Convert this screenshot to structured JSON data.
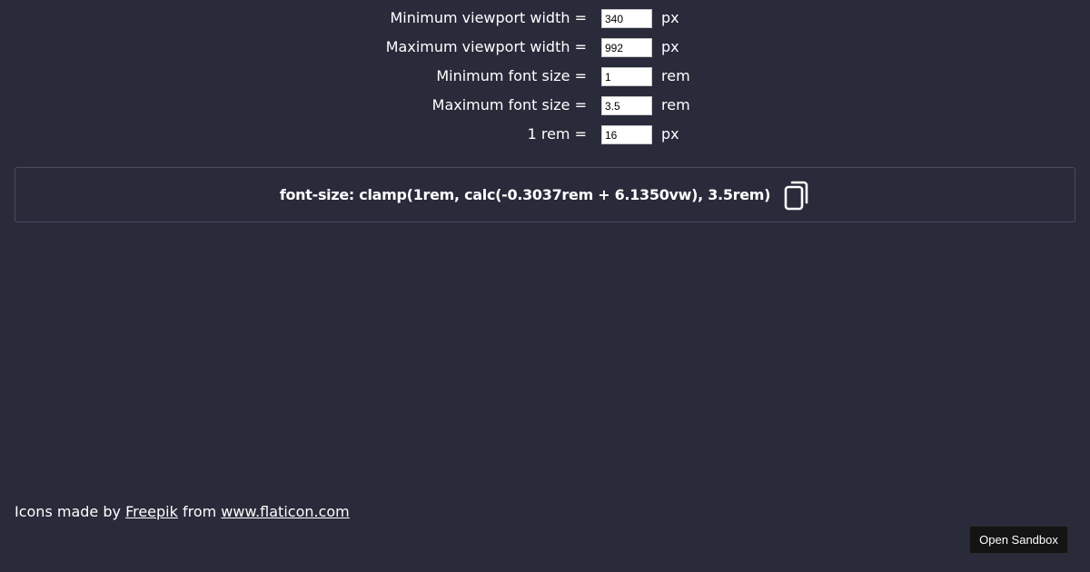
{
  "form": {
    "rows": [
      {
        "label": "Minimum viewport width =",
        "value": "340",
        "unit": "px"
      },
      {
        "label": "Maximum viewport width =",
        "value": "992",
        "unit": "px"
      },
      {
        "label": "Minimum font size =",
        "value": "1",
        "unit": "rem"
      },
      {
        "label": "Maximum font size =",
        "value": "3.5",
        "unit": "rem"
      },
      {
        "label": "1 rem =",
        "value": "16",
        "unit": "px"
      }
    ]
  },
  "result": {
    "code": "font-size: clamp(1rem, calc(-0.3037rem + 6.1350vw), 3.5rem)",
    "copy_icon": "copy-icon"
  },
  "credits": {
    "prefix": "Icons made by ",
    "author_link": "Freepik",
    "middle": " from ",
    "site_link": "www.flaticon.com"
  },
  "sandbox": {
    "label": "Open Sandbox"
  },
  "colors": {
    "background": "#292a3a",
    "text": "#ffffff",
    "border": "#4a4b5c",
    "button": "#141414"
  }
}
